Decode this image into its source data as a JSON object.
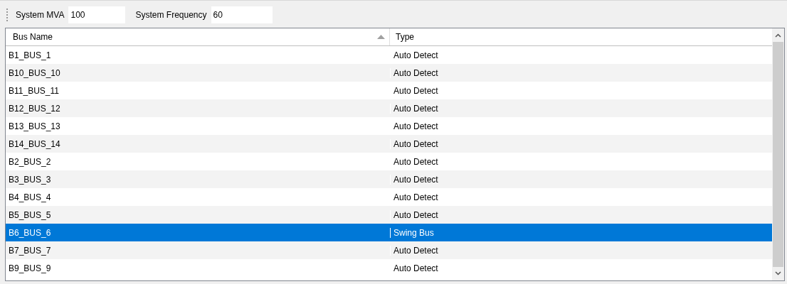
{
  "toolbar": {
    "fields": [
      {
        "label": "System MVA",
        "value": "100"
      },
      {
        "label": "System Frequency",
        "value": "60"
      }
    ]
  },
  "table": {
    "columns": [
      {
        "label": "Bus Name",
        "sorted": true
      },
      {
        "label": "Type",
        "sorted": false
      }
    ],
    "rows": [
      {
        "bus_name": "B1_BUS_1",
        "type": "Auto Detect",
        "selected": false
      },
      {
        "bus_name": "B10_BUS_10",
        "type": "Auto Detect",
        "selected": false
      },
      {
        "bus_name": "B11_BUS_11",
        "type": "Auto Detect",
        "selected": false
      },
      {
        "bus_name": "B12_BUS_12",
        "type": "Auto Detect",
        "selected": false
      },
      {
        "bus_name": "B13_BUS_13",
        "type": "Auto Detect",
        "selected": false
      },
      {
        "bus_name": "B14_BUS_14",
        "type": "Auto Detect",
        "selected": false
      },
      {
        "bus_name": "B2_BUS_2",
        "type": "Auto Detect",
        "selected": false
      },
      {
        "bus_name": "B3_BUS_3",
        "type": "Auto Detect",
        "selected": false
      },
      {
        "bus_name": "B4_BUS_4",
        "type": "Auto Detect",
        "selected": false
      },
      {
        "bus_name": "B5_BUS_5",
        "type": "Auto Detect",
        "selected": false
      },
      {
        "bus_name": "B6_BUS_6",
        "type": "Swing Bus",
        "selected": true
      },
      {
        "bus_name": "B7_BUS_7",
        "type": "Auto Detect",
        "selected": false
      },
      {
        "bus_name": "B9_BUS_9",
        "type": "Auto Detect",
        "selected": false
      }
    ]
  }
}
